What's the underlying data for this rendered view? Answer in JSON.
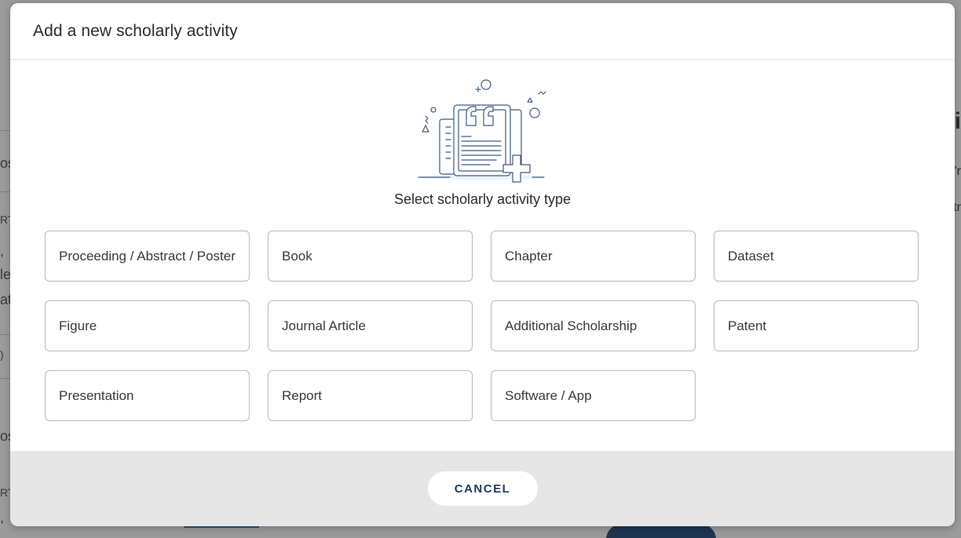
{
  "background": {
    "left_fragments": [
      "os",
      "RT",
      ",",
      "le",
      "at",
      ")",
      "os",
      "RT",
      ","
    ],
    "right_fragments": [
      "i",
      "'r",
      "tr"
    ]
  },
  "modal": {
    "title": "Add a new scholarly activity",
    "illustration_icon": "document-quote-plus-illustration",
    "subtitle": "Select scholarly activity type",
    "options": [
      "Proceeding / Abstract / Poster",
      "Book",
      "Chapter",
      "Dataset",
      "Figure",
      "Journal Article",
      "Additional Scholarship",
      "Patent",
      "Presentation",
      "Report",
      "Software / App"
    ],
    "cancel_label": "CANCEL"
  },
  "colors": {
    "accent": "#1e3a5f",
    "option_border": "#b4bcc6",
    "footer_bg": "#e6e6e6",
    "illustration_stroke": "#3d5a85"
  }
}
